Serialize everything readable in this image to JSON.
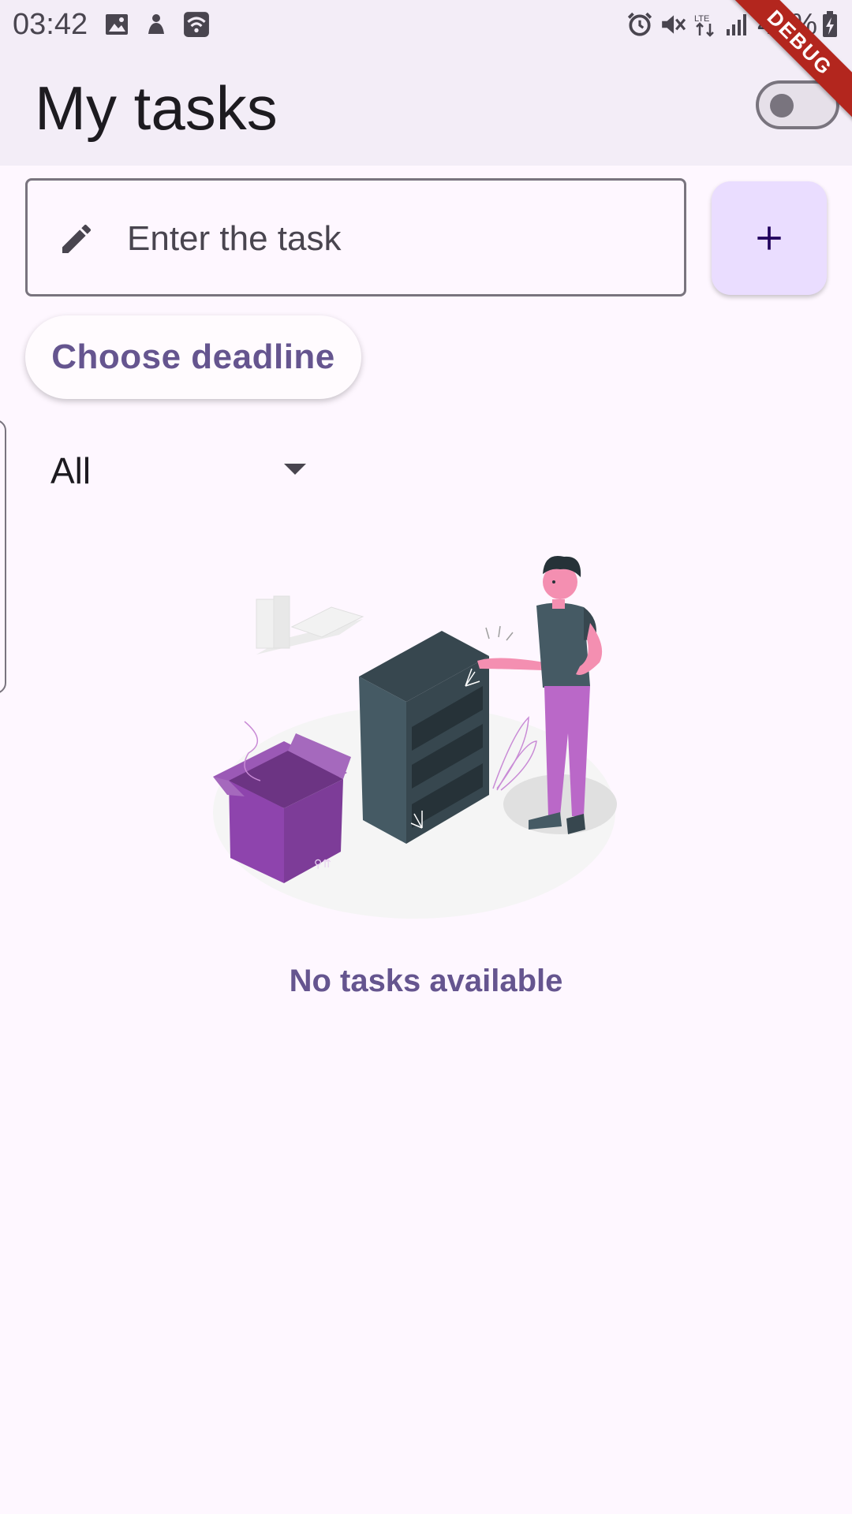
{
  "status_bar": {
    "time": "03:42",
    "battery_pct": "40%",
    "icons_left": [
      "gallery-icon",
      "notification-icon",
      "wifi-icon"
    ],
    "icons_right": [
      "alarm-icon",
      "mute-icon",
      "lte-icon",
      "signal-icon",
      "battery-charging-icon"
    ]
  },
  "app_bar": {
    "title": "My tasks",
    "theme_switch_on": false,
    "debug_banner": "DEBUG"
  },
  "task_input": {
    "placeholder": "Enter the task",
    "value": "",
    "icon": "pencil-icon"
  },
  "add_button": {
    "icon": "plus-icon"
  },
  "deadline_button": {
    "label": "Choose deadline"
  },
  "filter": {
    "selected": "All"
  },
  "empty_state": {
    "message": "No tasks available",
    "illustration": "empty-shelf-illustration"
  },
  "colors": {
    "primary": "#65558f",
    "surface": "#fef7ff",
    "app_bar": "#f3edf7",
    "fab": "#eaddff",
    "box": "#8e4a9c",
    "shelf": "#455a64",
    "debug": "#b3261e"
  }
}
